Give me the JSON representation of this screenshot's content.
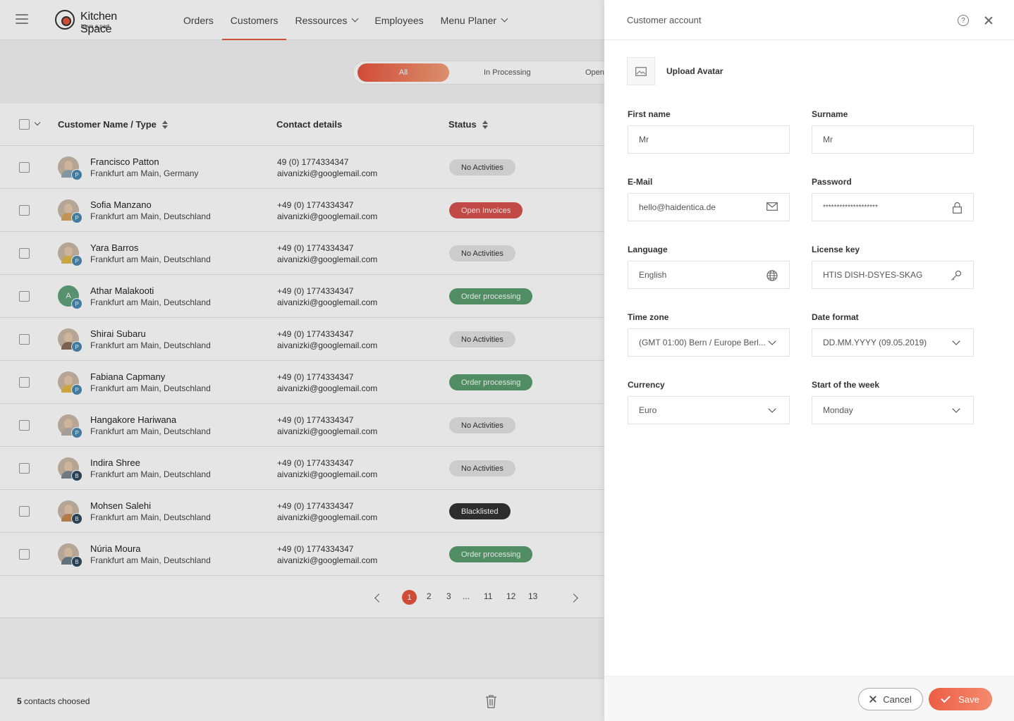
{
  "header": {
    "brand": "Kitchen Space",
    "tagline": "have a part",
    "nav": [
      {
        "label": "Orders",
        "active": false,
        "dropdown": false
      },
      {
        "label": "Customers",
        "active": true,
        "dropdown": false
      },
      {
        "label": "Ressources",
        "active": false,
        "dropdown": true
      },
      {
        "label": "Employees",
        "active": false,
        "dropdown": false
      },
      {
        "label": "Menu Planer",
        "active": false,
        "dropdown": true
      }
    ]
  },
  "filters": {
    "all": "All",
    "in_processing": "In Processing",
    "open": "Open"
  },
  "table": {
    "columns": {
      "name": "Customer Name / Type",
      "contact": "Contact details",
      "status": "Status"
    },
    "rows": [
      {
        "name": "Francisco Patton",
        "location": "Frankfurt am Main, Germany",
        "phone": " 49 (0) 1774334347",
        "email": "aivanizki@googlemail.com",
        "status": "No Activities",
        "type": "P",
        "initial": ""
      },
      {
        "name": "Sofia Manzano",
        "location": "Frankfurt am Main, Deutschland",
        "phone": "+49 (0) 1774334347",
        "email": "aivanizki@googlemail.com",
        "status": "Open Invoices",
        "type": "P",
        "initial": ""
      },
      {
        "name": "Yara Barros",
        "location": "Frankfurt am Main, Deutschland",
        "phone": "+49 (0) 1774334347",
        "email": "aivanizki@googlemail.com",
        "status": "No Activities",
        "type": "P",
        "initial": ""
      },
      {
        "name": "Athar Malakooti",
        "location": "Frankfurt am Main, Deutschland",
        "phone": "+49 (0) 1774334347",
        "email": "aivanizki@googlemail.com",
        "status": "Order processing",
        "type": "P",
        "initial": "A"
      },
      {
        "name": "Shirai Subaru",
        "location": "Frankfurt am Main, Deutschland",
        "phone": "+49 (0) 1774334347",
        "email": "aivanizki@googlemail.com",
        "status": "No Activities",
        "type": "P",
        "initial": ""
      },
      {
        "name": "Fabiana Capmany",
        "location": "Frankfurt am Main, Deutschland",
        "phone": "+49 (0) 1774334347",
        "email": "aivanizki@googlemail.com",
        "status": "Order processing",
        "type": "P",
        "initial": ""
      },
      {
        "name": "Hangakore Hariwana",
        "location": "Frankfurt am Main, Deutschland",
        "phone": "+49 (0) 1774334347",
        "email": "aivanizki@googlemail.com",
        "status": "No Activities",
        "type": "P",
        "initial": ""
      },
      {
        "name": "Indira Shree",
        "location": "Frankfurt am Main, Deutschland",
        "phone": "+49 (0) 1774334347",
        "email": "aivanizki@googlemail.com",
        "status": "No Activities",
        "type": "B",
        "initial": ""
      },
      {
        "name": "Mohsen Salehi",
        "location": "Frankfurt am Main, Deutschland",
        "phone": "+49 (0) 1774334347",
        "email": "aivanizki@googlemail.com",
        "status": "Blacklisted",
        "type": "B",
        "initial": ""
      },
      {
        "name": "Núria Moura",
        "location": "Frankfurt am Main, Deutschland",
        "phone": "+49 (0) 1774334347",
        "email": "aivanizki@googlemail.com",
        "status": "Order processing",
        "type": "B",
        "initial": ""
      }
    ]
  },
  "pagination": {
    "current": "1",
    "pages": [
      "2",
      "3",
      "...",
      "11",
      "12",
      "13"
    ]
  },
  "footer": {
    "selected_count": "5",
    "selected_label": " contacts choosed"
  },
  "drawer": {
    "title": "Customer account",
    "upload_label": "Upload Avatar",
    "first_name": {
      "label": "First name",
      "value": "Mr"
    },
    "surname": {
      "label": "Surname",
      "value": "Mr"
    },
    "email": {
      "label": "E-Mail",
      "value": "hello@haidentica.de"
    },
    "password": {
      "label": "Password",
      "value": "********************"
    },
    "language": {
      "label": "Language",
      "value": "English"
    },
    "license": {
      "label": "License key",
      "value": "HTIS DISH-DSYES-SKAG"
    },
    "timezone": {
      "label": "Time zone",
      "value": "(GMT 01:00) Bern / Europe Berl..."
    },
    "date_format": {
      "label": "Date format",
      "value": "DD.MM.YYYY (09.05.2019)"
    },
    "currency": {
      "label": "Currency",
      "value": "Euro"
    },
    "week_start": {
      "label": "Start of the week",
      "value": "Monday"
    },
    "cancel_label": "Cancel",
    "save_label": "Save"
  },
  "colors": {
    "accent": "#e8553e",
    "no_activities": "#e4e4e4",
    "open_invoices": "#d9534f",
    "order_processing": "#5a9e6f",
    "blacklisted": "#333333",
    "type_p": "#4a8ab0",
    "type_b": "#2f4a60"
  }
}
